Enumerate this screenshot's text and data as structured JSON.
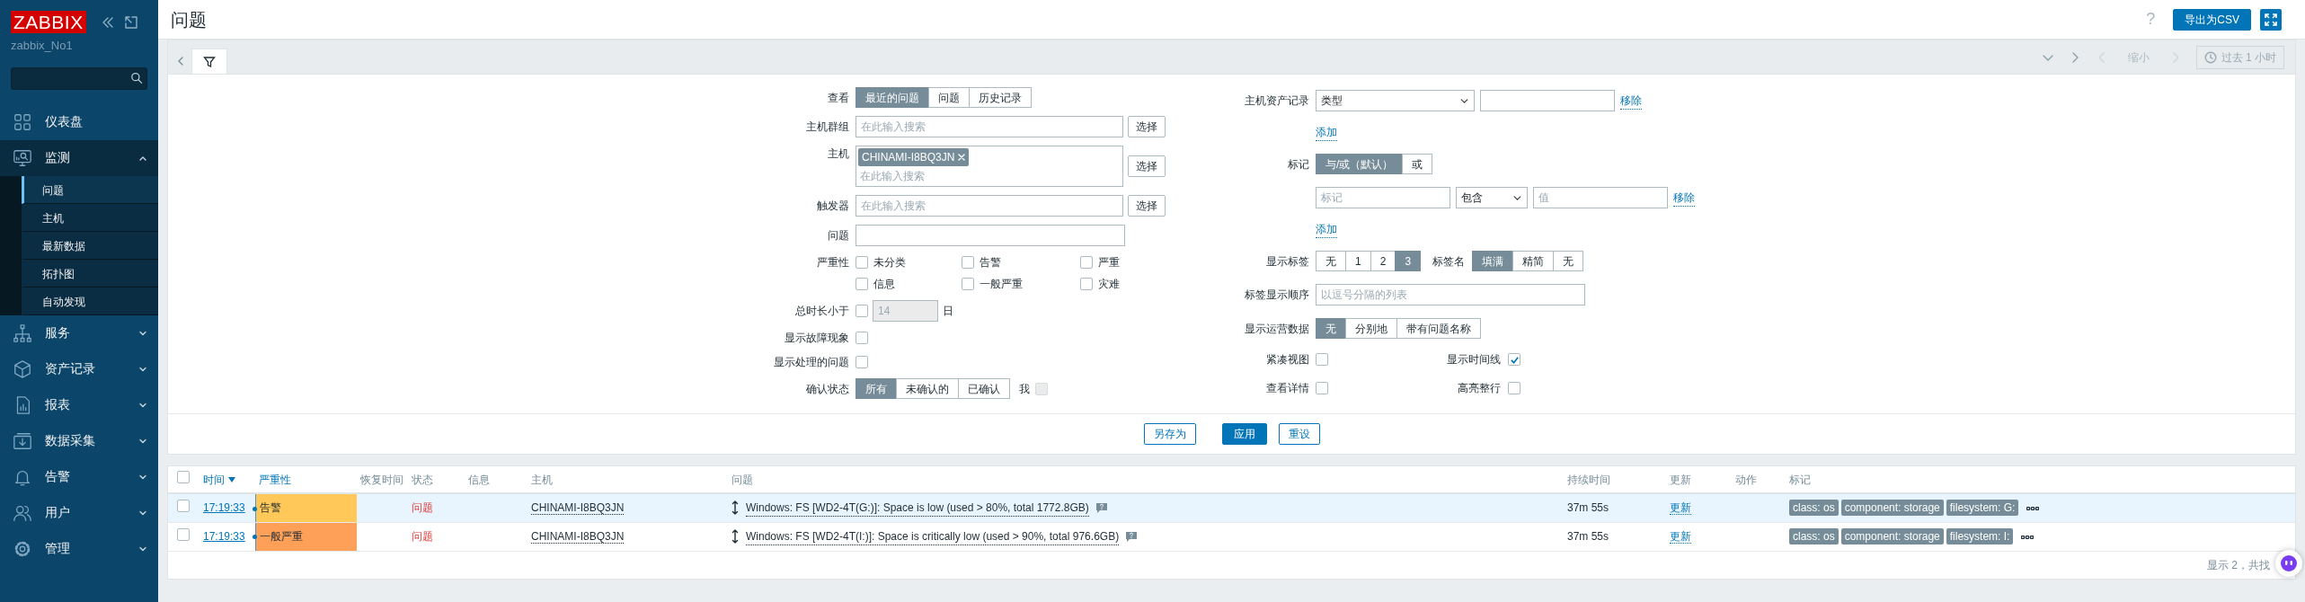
{
  "sidebar": {
    "logo": "ZABBIX",
    "server": "zabbix_No1",
    "items": [
      {
        "label": "仪表盘",
        "selected": false
      },
      {
        "label": "监测",
        "selected": true,
        "expanded": true,
        "children": [
          {
            "label": "问题",
            "selected": true
          },
          {
            "label": "主机",
            "selected": false
          },
          {
            "label": "最新数据",
            "selected": false
          },
          {
            "label": "拓扑图",
            "selected": false
          },
          {
            "label": "自动发现",
            "selected": false
          }
        ]
      },
      {
        "label": "服务",
        "selected": false,
        "expanded": false
      },
      {
        "label": "资产记录",
        "selected": false,
        "expanded": false
      },
      {
        "label": "报表",
        "selected": false,
        "expanded": false
      },
      {
        "label": "数据采集",
        "selected": false,
        "expanded": false
      },
      {
        "label": "告警",
        "selected": false,
        "expanded": false
      },
      {
        "label": "用户",
        "selected": false,
        "expanded": false
      },
      {
        "label": "管理",
        "selected": false,
        "expanded": false
      }
    ]
  },
  "header": {
    "title": "问题",
    "help": "?",
    "export_button": "导出为CSV"
  },
  "filter_tabs": {
    "filter_selected": true,
    "zoom_out": "缩小",
    "time_range": "过去 1 小时"
  },
  "filter": {
    "view": {
      "label": "查看",
      "options": [
        {
          "label": "最近的问题",
          "selected": true
        },
        {
          "label": "问题",
          "selected": false
        },
        {
          "label": "历史记录",
          "selected": false
        }
      ]
    },
    "host_groups": {
      "label": "主机群组",
      "placeholder": "在此输入搜索",
      "button": "选择"
    },
    "hosts": {
      "label": "主机",
      "chips": [
        "CHINAMI-I8BQ3JN"
      ],
      "placeholder": "在此输入搜索",
      "button": "选择"
    },
    "triggers": {
      "label": "触发器",
      "placeholder": "在此输入搜索",
      "button": "选择"
    },
    "problem": {
      "label": "问题"
    },
    "severity": {
      "label": "严重性",
      "options": [
        {
          "label": "未分类",
          "checked": false
        },
        {
          "label": "告警",
          "checked": false
        },
        {
          "label": "严重",
          "checked": false
        },
        {
          "label": "信息",
          "checked": false
        },
        {
          "label": "一般严重",
          "checked": false
        },
        {
          "label": "灾难",
          "checked": false
        }
      ]
    },
    "age": {
      "label": "总时长小于",
      "checked": false,
      "value": "14",
      "unit": "日"
    },
    "show_symptoms": {
      "label": "显示故障现象",
      "checked": false
    },
    "show_suppressed": {
      "label": "显示处理的问题",
      "checked": false
    },
    "acknowledgement": {
      "label": "确认状态",
      "options": [
        {
          "label": "所有",
          "selected": true
        },
        {
          "label": "未确认的",
          "selected": false
        },
        {
          "label": "已确认",
          "selected": false
        }
      ],
      "me_label": "我",
      "me_checked": false,
      "me_disabled": true
    },
    "inventory": {
      "label": "主机资产记录",
      "field": "类型",
      "remove": "移除",
      "add": "添加"
    },
    "tags": {
      "label": "标记",
      "operators": [
        {
          "label": "与/或（默认）",
          "selected": true
        },
        {
          "label": "或",
          "selected": false
        }
      ],
      "rows": [
        {
          "tag_placeholder": "标记",
          "condition": "包含",
          "value_placeholder": "值",
          "remove": "移除"
        }
      ],
      "add": "添加"
    },
    "show_tags": {
      "label": "显示标签",
      "options": [
        {
          "label": "无",
          "selected": false
        },
        {
          "label": "1",
          "selected": false
        },
        {
          "label": "2",
          "selected": false
        },
        {
          "label": "3",
          "selected": true
        }
      ]
    },
    "tag_name": {
      "label": "标签名",
      "options": [
        {
          "label": "填满",
          "selected": true
        },
        {
          "label": "精简",
          "selected": false
        },
        {
          "label": "无",
          "selected": false
        }
      ]
    },
    "tag_priority": {
      "label": "标签显示顺序",
      "placeholder": "以逗号分隔的列表"
    },
    "show_opdata": {
      "label": "显示运营数据",
      "options": [
        {
          "label": "无",
          "selected": true
        },
        {
          "label": "分别地",
          "selected": false
        },
        {
          "label": "带有问题名称",
          "selected": false
        }
      ]
    },
    "compact_view": {
      "label": "紧凑视图",
      "checked": false
    },
    "show_timeline": {
      "label": "显示时间线",
      "checked": true
    },
    "details": {
      "label": "查看详情",
      "checked": false
    },
    "highlight_row": {
      "label": "高亮整行",
      "checked": false
    },
    "buttons": [
      {
        "label": "另存为",
        "kind": "outline"
      },
      {
        "label": "应用",
        "kind": "primary"
      },
      {
        "label": "重设",
        "kind": "outline"
      }
    ]
  },
  "table": {
    "select_all": false,
    "columns": [
      {
        "label": "时间",
        "link": true,
        "sorted": true
      },
      {
        "label": "严重性",
        "link": true,
        "sorted": false
      },
      {
        "label": "恢复时间",
        "link": false,
        "sorted": false
      },
      {
        "label": "状态",
        "link": false,
        "sorted": false
      },
      {
        "label": "信息",
        "link": false,
        "sorted": false
      },
      {
        "label": "主机",
        "link": false,
        "sorted": false
      },
      {
        "label": "问题",
        "link": false,
        "sorted": false
      },
      {
        "label": "持续时间",
        "link": false,
        "sorted": false
      },
      {
        "label": "更新",
        "link": false,
        "sorted": false
      },
      {
        "label": "动作",
        "link": false,
        "sorted": false
      },
      {
        "label": "标记",
        "link": false,
        "sorted": false
      }
    ],
    "rows": [
      {
        "checked": false,
        "highlighted": true,
        "time": "17:19:33",
        "severity": "告警",
        "color": "#ffc859",
        "status": "问题",
        "host": "CHINAMI-I8BQ3JN",
        "problem": "Windows: FS [WD2-4T(G:)]: Space is low (used > 80%, total 1772.8GB)",
        "duration": "37m 55s",
        "update": "更新",
        "tags": [
          "class: os",
          "component: storage",
          "filesystem: G:"
        ]
      },
      {
        "checked": false,
        "highlighted": false,
        "time": "17:19:33",
        "severity": "一般严重",
        "color": "#ffa059",
        "status": "问题",
        "host": "CHINAMI-I8BQ3JN",
        "problem": "Windows: FS [WD2-4T(I:)]: Space is critically low (used > 90%, total 976.6GB)",
        "duration": "37m 55s",
        "update": "更新",
        "tags": [
          "class: os",
          "component: storage",
          "filesystem: I:"
        ]
      }
    ],
    "footer": "显示 2，共找"
  }
}
